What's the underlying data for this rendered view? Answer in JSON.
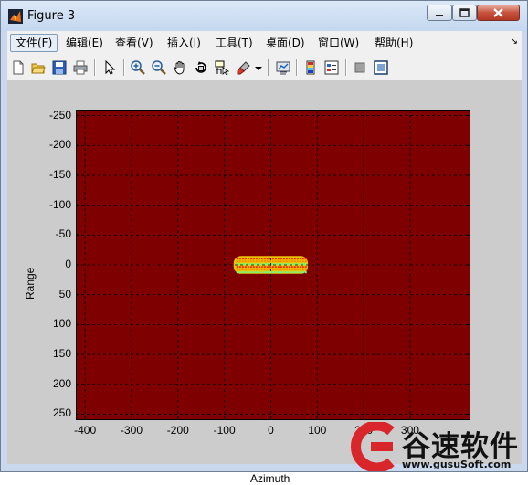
{
  "window": {
    "title": "Figure 3",
    "controls": {
      "minimize": "minimize",
      "maximize": "maximize",
      "close": "close"
    }
  },
  "menubar": {
    "items": [
      {
        "label": "文件(F)",
        "active": true
      },
      {
        "label": "编辑(E)"
      },
      {
        "label": "查看(V)"
      },
      {
        "label": "插入(I)"
      },
      {
        "label": "工具(T)"
      },
      {
        "label": "桌面(D)"
      },
      {
        "label": "窗口(W)"
      },
      {
        "label": "帮助(H)"
      }
    ],
    "corner_glyph": "↘"
  },
  "toolbar": {
    "buttons": [
      {
        "icon": "new-figure-icon"
      },
      {
        "icon": "open-file-icon"
      },
      {
        "icon": "save-figure-icon"
      },
      {
        "icon": "print-figure-icon"
      },
      {
        "icon": "edit-plot-arrow-icon"
      },
      {
        "icon": "zoom-in-icon"
      },
      {
        "icon": "zoom-out-icon"
      },
      {
        "icon": "pan-hand-icon"
      },
      {
        "icon": "rotate-3d-icon"
      },
      {
        "icon": "data-cursor-icon"
      },
      {
        "icon": "brush-icon"
      },
      {
        "icon": "link-plot-icon"
      },
      {
        "icon": "insert-colorbar-icon"
      },
      {
        "icon": "insert-legend-icon"
      },
      {
        "icon": "hide-plot-tools-icon"
      },
      {
        "icon": "show-plot-tools-icon"
      }
    ]
  },
  "plot": {
    "xlabel": "Azimuth",
    "ylabel": "Range",
    "x_ticks": [
      "-400",
      "-300",
      "-200",
      "-100",
      "0",
      "100",
      "200",
      "300"
    ],
    "y_ticks": [
      "-250",
      "-200",
      "-150",
      "-100",
      "-50",
      "0",
      "50",
      "100",
      "150",
      "200",
      "250"
    ],
    "xlim": [
      -420,
      430
    ],
    "ylim_reversed": [
      -260,
      260
    ],
    "background_color": "#7f0000",
    "grid": "on, dashed black",
    "target_region": {
      "azimuth": [
        -80,
        80
      ],
      "range": [
        -15,
        15
      ]
    }
  },
  "watermark": {
    "title": "谷速软件",
    "url": "www.gusuSoft.com",
    "logo_color": "#d9262a"
  },
  "chart_data": {
    "type": "heatmap",
    "xlabel": "Azimuth",
    "ylabel": "Range",
    "xlim": [
      -420,
      430
    ],
    "ylim": [
      260,
      -260
    ],
    "x_ticks": [
      -400,
      -300,
      -200,
      -100,
      0,
      100,
      200,
      300
    ],
    "y_ticks": [
      -250,
      -200,
      -150,
      -100,
      -50,
      0,
      50,
      100,
      150,
      200,
      250
    ],
    "grid": true,
    "colormap": "jet",
    "background_value_color": "#7f0000",
    "hot_region": {
      "azimuth": [
        -80,
        80
      ],
      "range": [
        -15,
        15
      ]
    }
  }
}
